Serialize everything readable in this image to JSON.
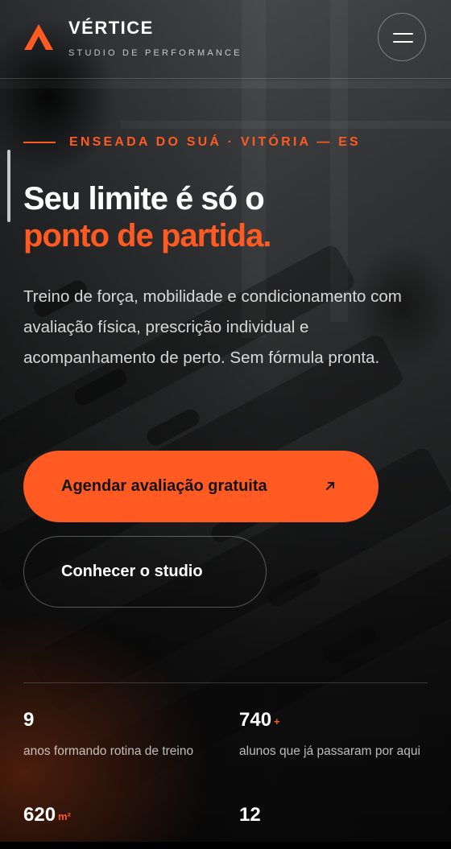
{
  "header": {
    "brand_name": "VÉRTICE",
    "brand_sub": "STUDIO DE PERFORMANCE",
    "menu_icon": "hamburger-icon"
  },
  "hero": {
    "eyebrow": "ENSEADA DO SUÁ · VITÓRIA — ES",
    "title_line1": "Seu limite é só o",
    "title_line2": "ponto de partida.",
    "lead": "Treino de força, mobilidade e condicionamento com avaliação física, prescrição individual e acompanhamento de perto. Sem fórmula pronta.",
    "cta_label": "Agendar avaliação gratuita",
    "cta_icon": "arrow-up-right-icon",
    "secondary_label": "Conhecer o studio"
  },
  "stats": [
    {
      "value": "9",
      "suffix": "",
      "label": "anos formando rotina de treino"
    },
    {
      "value": "740",
      "suffix": "+",
      "label": "alunos que já passaram por aqui"
    },
    {
      "value": "620",
      "suffix": "m²",
      "label": ""
    },
    {
      "value": "12",
      "suffix": "",
      "label": ""
    }
  ],
  "colors": {
    "accent": "#ff5a22",
    "background": "#111111",
    "text": "#ffffff"
  }
}
